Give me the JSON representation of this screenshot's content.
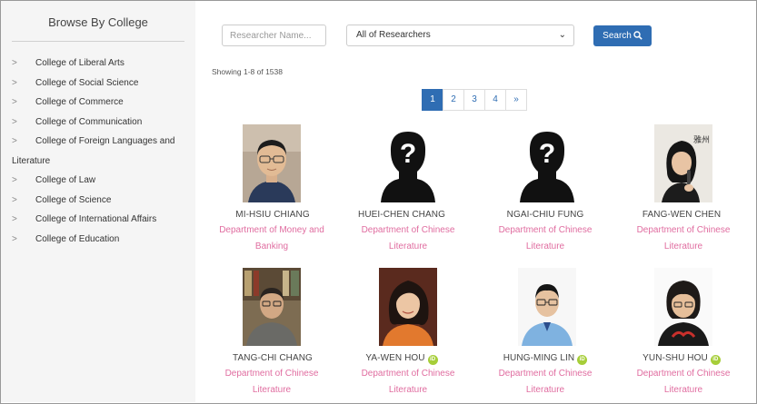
{
  "sidebar": {
    "title": "Browse By College",
    "items": [
      {
        "label": "College of Liberal Arts"
      },
      {
        "label": "College of Social Science"
      },
      {
        "label": "College of Commerce"
      },
      {
        "label": "College of Communication"
      },
      {
        "label": "College of Foreign Languages and",
        "cont": "Literature"
      },
      {
        "label": "College of Law"
      },
      {
        "label": "College of Science"
      },
      {
        "label": "College of International Affairs"
      },
      {
        "label": "College of Education"
      }
    ]
  },
  "search": {
    "placeholder": "Researcher Name...",
    "select_value": "All of Researchers",
    "button_label": "Search"
  },
  "results": {
    "showing": "Showing 1-8 of 1538"
  },
  "pagination": [
    "1",
    "2",
    "3",
    "4",
    "»"
  ],
  "researchers": [
    {
      "name": "MI-HSIU CHIANG",
      "dept1": "Department of Money and",
      "dept2": "Banking",
      "orcid": false
    },
    {
      "name": "HUEI-CHEN CHANG",
      "dept1": "Department of Chinese",
      "dept2": "Literature",
      "orcid": false
    },
    {
      "name": "NGAI-CHIU FUNG",
      "dept1": "Department of Chinese",
      "dept2": "Literature",
      "orcid": false
    },
    {
      "name": "FANG-WEN CHEN",
      "dept1": "Department of Chinese",
      "dept2": "Literature",
      "orcid": false
    },
    {
      "name": "TANG-CHI CHANG",
      "dept1": "Department of Chinese",
      "dept2": "Literature",
      "orcid": false
    },
    {
      "name": "YA-WEN HOU",
      "dept1": "Department of Chinese",
      "dept2": "Literature",
      "orcid": true
    },
    {
      "name": "HUNG-MING LIN",
      "dept1": "Department of Chinese",
      "dept2": "Literature",
      "orcid": true
    },
    {
      "name": "YUN-SHU HOU",
      "dept1": "Department of Chinese",
      "dept2": "Literature",
      "orcid": true
    }
  ],
  "badges": {
    "orcid": "iD"
  },
  "photo_watermark": "雅州",
  "colors": {
    "accent": "#2f6db3",
    "dept_link": "#e06da0",
    "orcid": "#a6ce39",
    "sidebar_bg": "#f5f5f5"
  }
}
